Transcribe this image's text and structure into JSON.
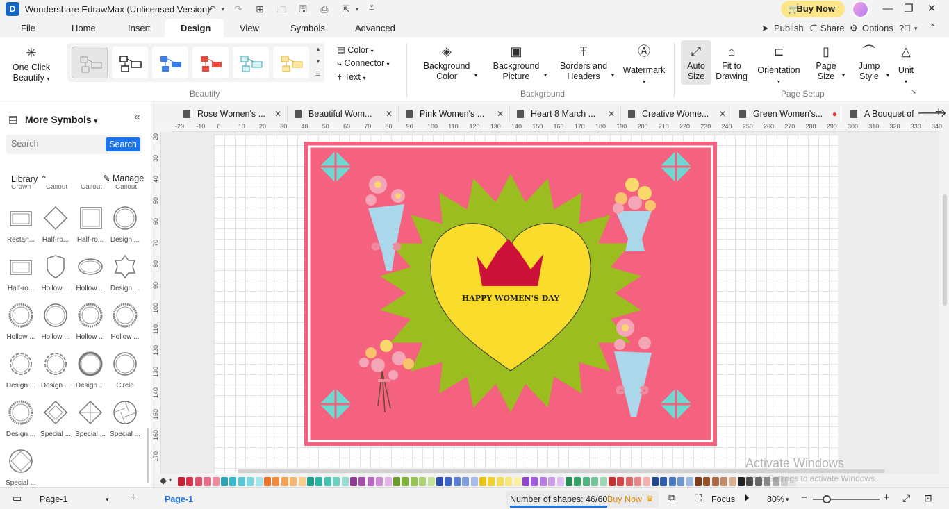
{
  "window": {
    "title": "Wondershare EdrawMax (Unlicensed Version)",
    "buy_now": "Buy Now"
  },
  "menu": {
    "items": [
      "File",
      "Home",
      "Insert",
      "Design",
      "View",
      "Symbols",
      "Advanced"
    ],
    "active": "Design",
    "publish": "Publish",
    "share": "Share",
    "options": "Options"
  },
  "ribbon": {
    "one_click_beautify_1": "One Click",
    "one_click_beautify_2": "Beautify",
    "beautify_group": "Beautify",
    "color": "Color",
    "connector": "Connector",
    "text": "Text",
    "background_color_1": "Background",
    "background_color_2": "Color",
    "background_picture_1": "Background",
    "background_picture_2": "Picture",
    "borders_headers_1": "Borders and",
    "borders_headers_2": "Headers",
    "watermark": "Watermark",
    "background_group": "Background",
    "auto_size_1": "Auto",
    "auto_size_2": "Size",
    "fit_drawing_1": "Fit to",
    "fit_drawing_2": "Drawing",
    "orientation": "Orientation",
    "page_size_1": "Page",
    "page_size_2": "Size",
    "jump_style_1": "Jump",
    "jump_style_2": "Style",
    "unit": "Unit",
    "page_setup_group": "Page Setup"
  },
  "left_panel": {
    "title": "More Symbols",
    "search_placeholder": "Search",
    "search_button": "Search",
    "library": "Library",
    "manage": "Manage",
    "top_labels": [
      "Crown",
      "Callout",
      "Callout",
      "Callout"
    ],
    "shapes": [
      "Rectan...",
      "Half-ro...",
      "Half-ro...",
      "Design ...",
      "Half-ro...",
      "Hollow ...",
      "Hollow ...",
      "Design ...",
      "Hollow ...",
      "Hollow ...",
      "Hollow ...",
      "Hollow ...",
      "Design ...",
      "Design ...",
      "Design ...",
      "Circle",
      "Design ...",
      "Special ...",
      "Special ...",
      "Special ...",
      "Special ..."
    ]
  },
  "tabs": [
    {
      "label": "Rose Women's ...",
      "modified": false
    },
    {
      "label": "Beautiful Wom...",
      "modified": false
    },
    {
      "label": "Pink Women's ...",
      "modified": false
    },
    {
      "label": "Heart 8 March ...",
      "modified": false
    },
    {
      "label": "Creative Wome...",
      "modified": false
    },
    {
      "label": "Green Women's...",
      "modified": true
    },
    {
      "label": "A Bouquet of",
      "modified": false
    }
  ],
  "ruler": {
    "h_ticks": [
      "-20",
      "-10",
      "0",
      "10",
      "20",
      "30",
      "40",
      "50",
      "60",
      "70",
      "80",
      "90",
      "100",
      "110",
      "120",
      "130",
      "140",
      "150",
      "160",
      "170",
      "180",
      "190",
      "200",
      "210",
      "220",
      "230",
      "240",
      "250",
      "260",
      "270",
      "280",
      "290",
      "300",
      "310",
      "320",
      "330",
      "340"
    ],
    "v_ticks": [
      "20",
      "30",
      "40",
      "50",
      "60",
      "70",
      "80",
      "90",
      "100",
      "110",
      "120",
      "130",
      "140",
      "150",
      "160",
      "170"
    ]
  },
  "card": {
    "text": "HAPPY WOMEN'S DAY",
    "bg_color": "#f4627f",
    "burst_color": "#9bbd1f",
    "heart_color": "#fadc2c",
    "crown_color": "#cc1238",
    "diamond_color": "#6dd9d0"
  },
  "status": {
    "page_selector": "Page-1",
    "active_page": "Page-1",
    "shapes_count": "Number of shapes: 46/60",
    "buy_now": "Buy Now",
    "focus": "Focus",
    "zoom": "80%",
    "activate_windows": "Activate Windows",
    "activate_sub": "Go to Settings to activate Windows."
  },
  "palette": [
    "#c62035",
    "#d9334d",
    "#e0506a",
    "#e56e86",
    "#ec8ea0",
    "#2fa3b5",
    "#3bb8c8",
    "#56c8d6",
    "#7bd5df",
    "#a7e3ea",
    "#e8742b",
    "#ef8b3e",
    "#f4a154",
    "#f6b86d",
    "#f9cd8b",
    "#1d9c8b",
    "#2db5a1",
    "#46c2b1",
    "#6ecfc1",
    "#98ddd3",
    "#8a3d91",
    "#a24ea9",
    "#b968c0",
    "#cf8bd4",
    "#e2b3e5",
    "#6a9a2c",
    "#7fb23a",
    "#96c552",
    "#acd273",
    "#c5e09a",
    "#2e4ea8",
    "#3d63c4",
    "#5a7fd2",
    "#7d9bde",
    "#a7bce9",
    "#e7c219",
    "#efd130",
    "#f4dd52",
    "#f7e67b",
    "#faefa6",
    "#8f45c9",
    "#a35cdb",
    "#b87be6",
    "#cb9cee",
    "#dfc1f5",
    "#2a8a56",
    "#36a268",
    "#4fb57e",
    "#74c598",
    "#9fd7b6",
    "#c23232",
    "#d44747",
    "#e06565",
    "#e98989",
    "#f1b1b1",
    "#244a8a",
    "#2e5ea8",
    "#4878bd",
    "#6e96cf",
    "#9cb7e0",
    "#7a3b1e",
    "#93512c",
    "#aa6a43",
    "#c18a66",
    "#d7b094",
    "#222222",
    "#444444",
    "#666666",
    "#888888",
    "#aaaaaa",
    "#cccccc",
    "#e6e6e6"
  ]
}
